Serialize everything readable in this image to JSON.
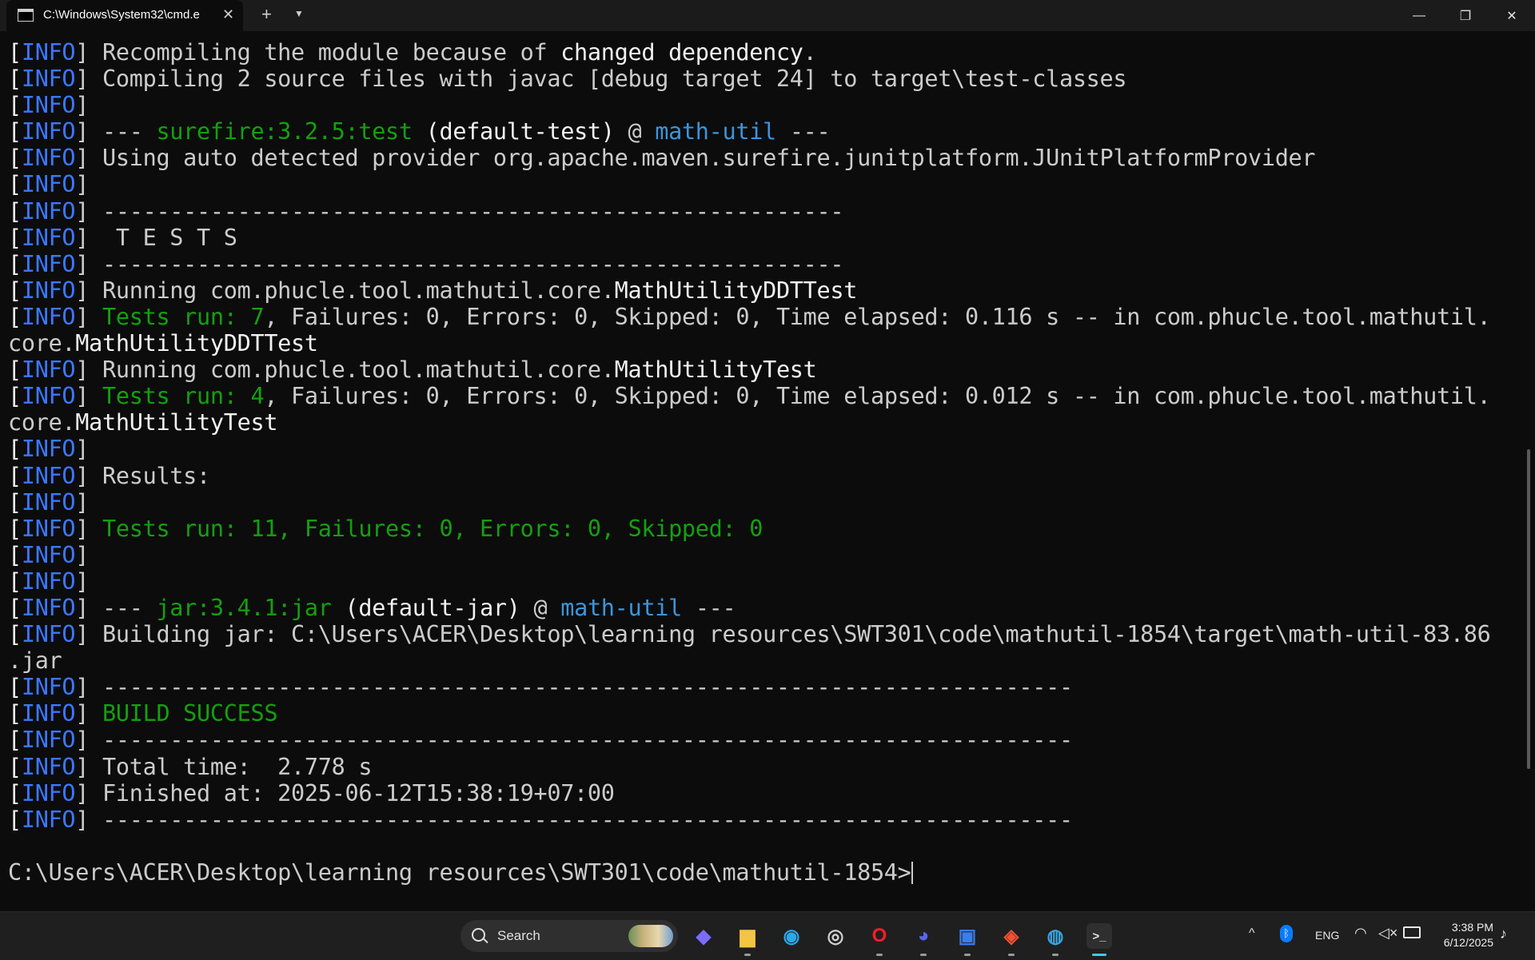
{
  "titlebar": {
    "tab_title": "C:\\Windows\\System32\\cmd.e",
    "tab_close": "✕",
    "new_tab": "+",
    "dropdown": "⌄",
    "minimize": "—",
    "maximize": "❐",
    "close": "✕"
  },
  "terminal": {
    "lines": [
      [
        {
          "t": "[",
          "c": "w"
        },
        {
          "t": "INFO",
          "c": "b"
        },
        {
          "t": "] Recompiling the module because of ",
          "c": ""
        },
        {
          "t": "changed dependency",
          "c": "w"
        },
        {
          "t": ".",
          "c": ""
        }
      ],
      [
        {
          "t": "[",
          "c": "w"
        },
        {
          "t": "INFO",
          "c": "b"
        },
        {
          "t": "] Compiling 2 source files with javac [debug target 24] to target\\test-classes",
          "c": ""
        }
      ],
      [
        {
          "t": "[",
          "c": "w"
        },
        {
          "t": "INFO",
          "c": "b"
        },
        {
          "t": "]",
          "c": ""
        }
      ],
      [
        {
          "t": "[",
          "c": "w"
        },
        {
          "t": "INFO",
          "c": "b"
        },
        {
          "t": "] --- ",
          "c": ""
        },
        {
          "t": "surefire:3.2.5:test",
          "c": "g"
        },
        {
          "t": " (default-test)",
          "c": "w"
        },
        {
          "t": " @ ",
          "c": ""
        },
        {
          "t": "math-util",
          "c": "c"
        },
        {
          "t": " ---",
          "c": ""
        }
      ],
      [
        {
          "t": "[",
          "c": "w"
        },
        {
          "t": "INFO",
          "c": "b"
        },
        {
          "t": "] Using auto detected provider org.apache.maven.surefire.junitplatform.JUnitPlatformProvider",
          "c": ""
        }
      ],
      [
        {
          "t": "[",
          "c": "w"
        },
        {
          "t": "INFO",
          "c": "b"
        },
        {
          "t": "]",
          "c": ""
        }
      ],
      [
        {
          "t": "[",
          "c": "w"
        },
        {
          "t": "INFO",
          "c": "b"
        },
        {
          "t": "] -------------------------------------------------------",
          "c": ""
        }
      ],
      [
        {
          "t": "[",
          "c": "w"
        },
        {
          "t": "INFO",
          "c": "b"
        },
        {
          "t": "]  T E S T S",
          "c": ""
        }
      ],
      [
        {
          "t": "[",
          "c": "w"
        },
        {
          "t": "INFO",
          "c": "b"
        },
        {
          "t": "] -------------------------------------------------------",
          "c": ""
        }
      ],
      [
        {
          "t": "[",
          "c": "w"
        },
        {
          "t": "INFO",
          "c": "b"
        },
        {
          "t": "] Running com.phucle.tool.mathutil.core.",
          "c": ""
        },
        {
          "t": "MathUtilityDDTTest",
          "c": "w"
        }
      ],
      [
        {
          "t": "[",
          "c": "w"
        },
        {
          "t": "INFO",
          "c": "b"
        },
        {
          "t": "] ",
          "c": ""
        },
        {
          "t": "Tests run: 7",
          "c": "g"
        },
        {
          "t": ", Failures: 0, Errors: 0, Skipped: 0, Time elapsed: 0.116 s -- in com.phucle.tool.mathutil.",
          "c": ""
        }
      ],
      [
        {
          "t": "core.",
          "c": ""
        },
        {
          "t": "MathUtilityDDTTest",
          "c": "w"
        }
      ],
      [
        {
          "t": "[",
          "c": "w"
        },
        {
          "t": "INFO",
          "c": "b"
        },
        {
          "t": "] Running com.phucle.tool.mathutil.core.",
          "c": ""
        },
        {
          "t": "MathUtilityTest",
          "c": "w"
        }
      ],
      [
        {
          "t": "[",
          "c": "w"
        },
        {
          "t": "INFO",
          "c": "b"
        },
        {
          "t": "] ",
          "c": ""
        },
        {
          "t": "Tests run: 4",
          "c": "g"
        },
        {
          "t": ", Failures: 0, Errors: 0, Skipped: 0, Time elapsed: 0.012 s -- in com.phucle.tool.mathutil.",
          "c": ""
        }
      ],
      [
        {
          "t": "core.",
          "c": ""
        },
        {
          "t": "MathUtilityTest",
          "c": "w"
        }
      ],
      [
        {
          "t": "[",
          "c": "w"
        },
        {
          "t": "INFO",
          "c": "b"
        },
        {
          "t": "]",
          "c": ""
        }
      ],
      [
        {
          "t": "[",
          "c": "w"
        },
        {
          "t": "INFO",
          "c": "b"
        },
        {
          "t": "] Results:",
          "c": ""
        }
      ],
      [
        {
          "t": "[",
          "c": "w"
        },
        {
          "t": "INFO",
          "c": "b"
        },
        {
          "t": "]",
          "c": ""
        }
      ],
      [
        {
          "t": "[",
          "c": "w"
        },
        {
          "t": "INFO",
          "c": "b"
        },
        {
          "t": "] ",
          "c": ""
        },
        {
          "t": "Tests run: 11, Failures: 0, Errors: 0, Skipped: 0",
          "c": "g"
        }
      ],
      [
        {
          "t": "[",
          "c": "w"
        },
        {
          "t": "INFO",
          "c": "b"
        },
        {
          "t": "]",
          "c": ""
        }
      ],
      [
        {
          "t": "[",
          "c": "w"
        },
        {
          "t": "INFO",
          "c": "b"
        },
        {
          "t": "]",
          "c": ""
        }
      ],
      [
        {
          "t": "[",
          "c": "w"
        },
        {
          "t": "INFO",
          "c": "b"
        },
        {
          "t": "] --- ",
          "c": ""
        },
        {
          "t": "jar:3.4.1:jar",
          "c": "g"
        },
        {
          "t": " (default-jar)",
          "c": "w"
        },
        {
          "t": " @ ",
          "c": ""
        },
        {
          "t": "math-util",
          "c": "c"
        },
        {
          "t": " ---",
          "c": ""
        }
      ],
      [
        {
          "t": "[",
          "c": "w"
        },
        {
          "t": "INFO",
          "c": "b"
        },
        {
          "t": "] Building jar: C:\\Users\\ACER\\Desktop\\learning resources\\SWT301\\code\\mathutil-1854\\target\\math-util-83.86",
          "c": ""
        }
      ],
      [
        {
          "t": ".jar",
          "c": ""
        }
      ],
      [
        {
          "t": "[",
          "c": "w"
        },
        {
          "t": "INFO",
          "c": "b"
        },
        {
          "t": "] ------------------------------------------------------------------------",
          "c": ""
        }
      ],
      [
        {
          "t": "[",
          "c": "w"
        },
        {
          "t": "INFO",
          "c": "b"
        },
        {
          "t": "] ",
          "c": ""
        },
        {
          "t": "BUILD SUCCESS",
          "c": "g"
        }
      ],
      [
        {
          "t": "[",
          "c": "w"
        },
        {
          "t": "INFO",
          "c": "b"
        },
        {
          "t": "] ------------------------------------------------------------------------",
          "c": ""
        }
      ],
      [
        {
          "t": "[",
          "c": "w"
        },
        {
          "t": "INFO",
          "c": "b"
        },
        {
          "t": "] Total time:  2.778 s",
          "c": ""
        }
      ],
      [
        {
          "t": "[",
          "c": "w"
        },
        {
          "t": "INFO",
          "c": "b"
        },
        {
          "t": "] Finished at: 2025-06-12T15:38:19+07:00",
          "c": ""
        }
      ],
      [
        {
          "t": "[",
          "c": "w"
        },
        {
          "t": "INFO",
          "c": "b"
        },
        {
          "t": "] ------------------------------------------------------------------------",
          "c": ""
        }
      ],
      [],
      [
        {
          "t": "C:\\Users\\ACER\\Desktop\\learning resources\\SWT301\\code\\mathutil-1854>",
          "c": ""
        }
      ]
    ],
    "prompt_line_index": 31
  },
  "taskbar": {
    "search_label": "Search",
    "apps": [
      {
        "name": "copilot-icon",
        "glyph": "◆",
        "color": "#7b6cff",
        "running": false
      },
      {
        "name": "file-explorer-icon",
        "glyph": "▆",
        "color": "#f4c542",
        "running": true
      },
      {
        "name": "edge-icon",
        "glyph": "◉",
        "color": "#2fa6e8",
        "running": false
      },
      {
        "name": "obs-icon",
        "glyph": "◎",
        "color": "#d0d0d0",
        "running": false
      },
      {
        "name": "opera-icon",
        "glyph": "O",
        "color": "#ff1b2d",
        "running": true
      },
      {
        "name": "discord-icon",
        "glyph": "◕",
        "color": "#5865f2",
        "running": true
      },
      {
        "name": "intellij-icon",
        "glyph": "▣",
        "color": "#3d7cf0",
        "running": true
      },
      {
        "name": "git-icon",
        "glyph": "◈",
        "color": "#f05133",
        "running": true
      },
      {
        "name": "globe-icon",
        "glyph": "◍",
        "color": "#38a6e0",
        "running": true
      },
      {
        "name": "terminal-icon",
        "glyph": ">_",
        "color": "#e0e0e0",
        "running": true,
        "active": true
      }
    ],
    "tray": {
      "chevron": "^",
      "bluetooth": "ᛒ",
      "language": "ENG",
      "wifi": "◠",
      "volume": "🔇",
      "notification": "🔔"
    },
    "clock_time": "3:38 PM",
    "clock_date": "6/12/2025"
  },
  "colors": {
    "info": "#3b78ff",
    "green": "#13a10e",
    "cyan": "#3a96dd",
    "text": "#cccccc",
    "bright": "#f2f2f2",
    "background": "#0c0c0c"
  }
}
